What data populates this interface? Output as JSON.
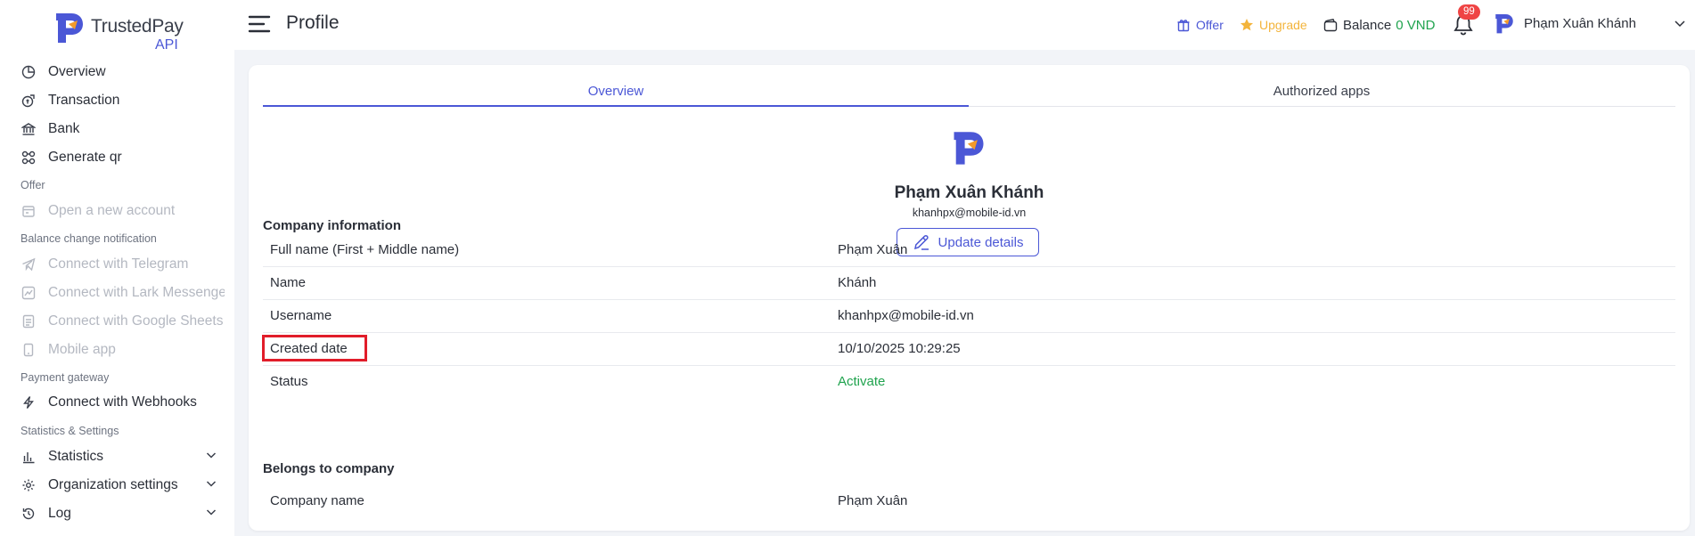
{
  "brand": {
    "name": "TrustedPay",
    "sub": "API"
  },
  "sidebar": {
    "items": [
      {
        "label": "Overview",
        "icon": "chart-pie-icon",
        "disabled": false
      },
      {
        "label": "Transaction",
        "icon": "coins-icon",
        "disabled": false
      },
      {
        "label": "Bank",
        "icon": "bank-icon",
        "disabled": false
      },
      {
        "label": "Generate qr",
        "icon": "qr-icon",
        "disabled": false
      }
    ],
    "sections": {
      "offer": "Offer",
      "balance": "Balance change notification",
      "payment": "Payment gateway",
      "stats": "Statistics & Settings"
    },
    "offer_items": [
      {
        "label": "Open a new account",
        "icon": "add-card-icon"
      }
    ],
    "balance_items": [
      {
        "label": "Connect with Telegram",
        "icon": "telegram-icon"
      },
      {
        "label": "Connect with Lark Messenger",
        "icon": "lark-icon"
      },
      {
        "label": "Connect with Google Sheets",
        "icon": "sheets-icon"
      },
      {
        "label": "Mobile app",
        "icon": "mobile-icon"
      }
    ],
    "payment_items": [
      {
        "label": "Connect with Webhooks",
        "icon": "lightning-icon"
      }
    ],
    "stats_items": [
      {
        "label": "Statistics",
        "icon": "bar-chart-icon"
      },
      {
        "label": "Organization settings",
        "icon": "gear-icon"
      },
      {
        "label": "Log",
        "icon": "history-icon"
      }
    ]
  },
  "header": {
    "title": "Profile",
    "offer": "Offer",
    "upgrade": "Upgrade",
    "balance_label": "Balance",
    "balance_value": "0 VND",
    "notifications": "99",
    "user_name": "Phạm Xuân Khánh"
  },
  "tabs": [
    {
      "label": "Overview",
      "active": true
    },
    {
      "label": "Authorized apps",
      "active": false
    }
  ],
  "profile": {
    "name": "Phạm Xuân Khánh",
    "email": "khanhpx@mobile-id.vn",
    "update_label": "Update details"
  },
  "company_info": {
    "title": "Company information",
    "rows": [
      {
        "label": "Full name (First + Middle name)",
        "value": "Phạm Xuân"
      },
      {
        "label": "Name",
        "value": "Khánh"
      },
      {
        "label": "Username",
        "value": "khanhpx@mobile-id.vn"
      },
      {
        "label": "Created date",
        "value": "10/10/2025 10:29:25"
      },
      {
        "label": "Status",
        "value": "Activate"
      }
    ]
  },
  "belongs": {
    "title": "Belongs to company",
    "rows": [
      {
        "label": "Company name",
        "value": "Phạm Xuân"
      }
    ]
  },
  "colors": {
    "accent": "#4b57d6",
    "success": "#20a34e",
    "warning": "#f3b43b",
    "danger": "#ef4444",
    "highlight": "#e11d2a"
  }
}
